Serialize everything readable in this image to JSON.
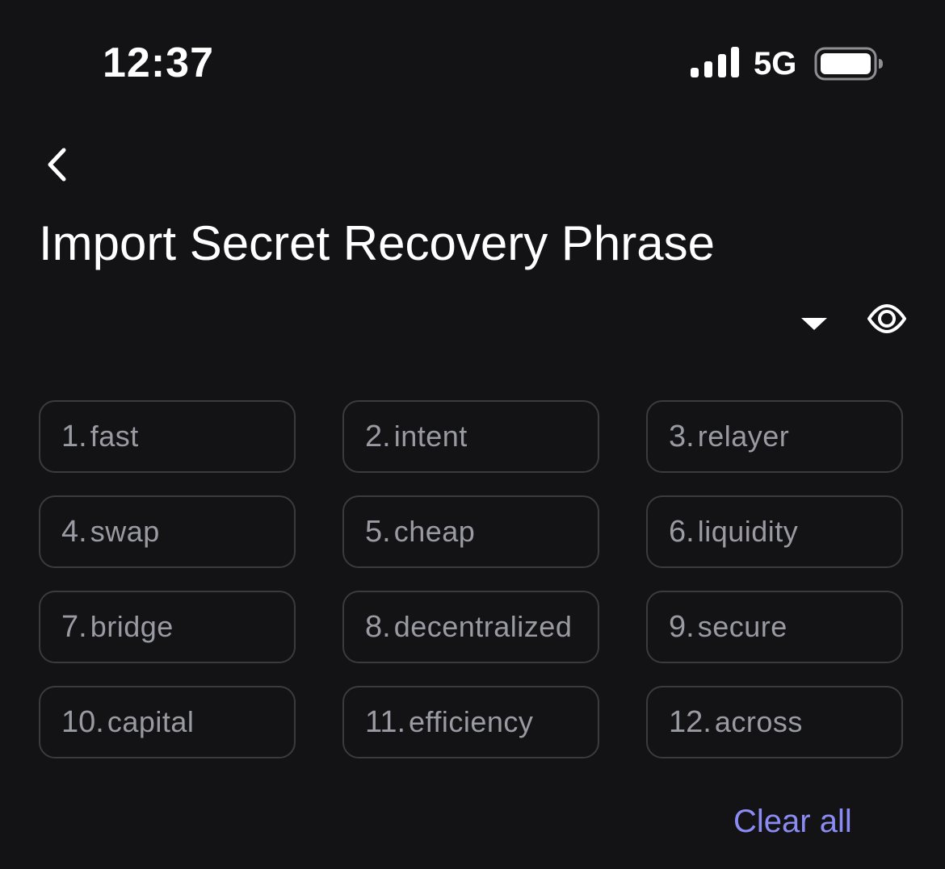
{
  "status_bar": {
    "time": "12:37",
    "network": "5G",
    "signal_icon": "cellular-signal-icon",
    "battery_icon": "battery-icon"
  },
  "header": {
    "back_icon": "chevron-left-icon",
    "title": "Import Secret Recovery Phrase",
    "dropdown_icon": "triangle-down-icon",
    "visibility_icon": "eye-icon"
  },
  "words": [
    {
      "index": "1.",
      "word": "fast"
    },
    {
      "index": "2.",
      "word": "intent"
    },
    {
      "index": "3.",
      "word": "relayer"
    },
    {
      "index": "4.",
      "word": "swap"
    },
    {
      "index": "5.",
      "word": "cheap"
    },
    {
      "index": "6.",
      "word": "liquidity"
    },
    {
      "index": "7.",
      "word": "bridge"
    },
    {
      "index": "8.",
      "word": "decentralized"
    },
    {
      "index": "9.",
      "word": "secure"
    },
    {
      "index": "10.",
      "word": "capital"
    },
    {
      "index": "11.",
      "word": "efficiency"
    },
    {
      "index": "12.",
      "word": "across"
    }
  ],
  "actions": {
    "clear_all_label": "Clear all"
  },
  "colors": {
    "background": "#131316",
    "field_border": "#3a3a40",
    "field_text": "#9a9aa3",
    "accent": "#8b8cf3"
  }
}
